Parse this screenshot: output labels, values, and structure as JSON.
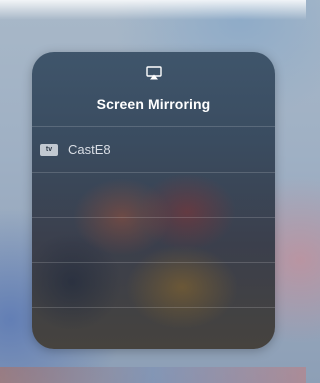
{
  "screen_mirroring": {
    "icon": "airplay-icon",
    "title": "Screen Mirroring",
    "devices": [
      {
        "icon": "appletv-icon",
        "badge": "tv",
        "name": "CastE8"
      }
    ]
  }
}
